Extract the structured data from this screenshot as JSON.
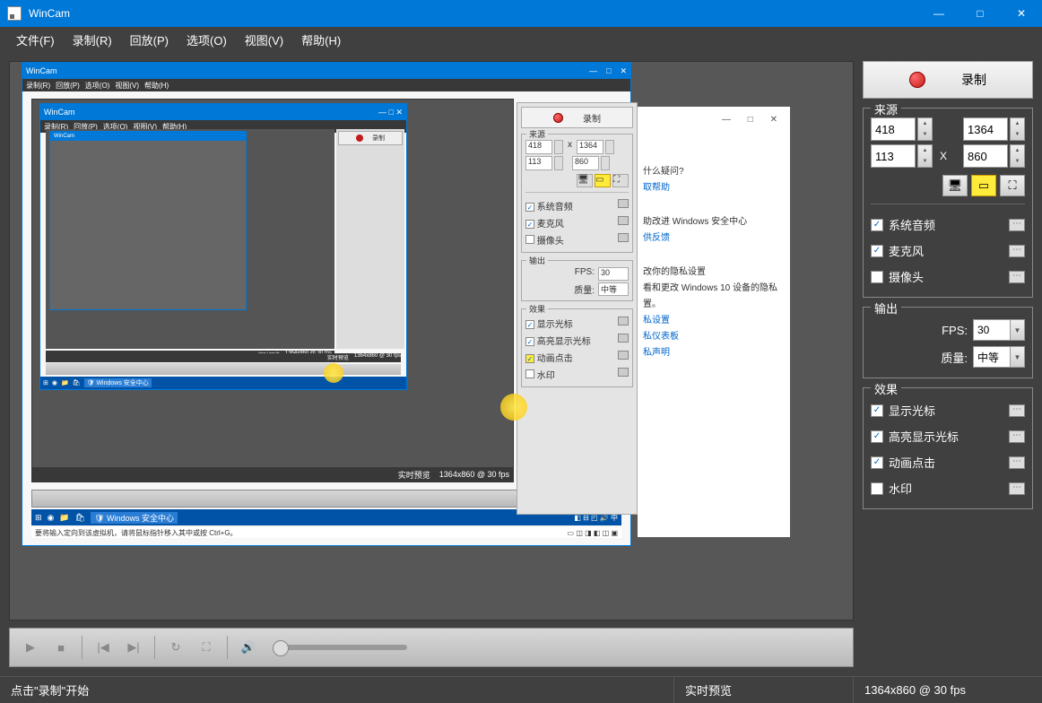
{
  "app": {
    "title": "WinCam"
  },
  "window_controls": {
    "min": "—",
    "max": "□",
    "close": "✕"
  },
  "menu": {
    "file": "文件(F)",
    "record": "录制(R)",
    "playback": "回放(P)",
    "options": "选项(O)",
    "view": "视图(V)",
    "help": "帮助(H)"
  },
  "record_button": {
    "label": "录制"
  },
  "panels": {
    "source": "来源",
    "output": "输出",
    "effects": "效果"
  },
  "source": {
    "x": "418",
    "y": "113",
    "w": "1364",
    "h": "860",
    "x_sep": "X"
  },
  "checks": {
    "system_audio": "系统音频",
    "microphone": "麦克风",
    "camera": "摄像头"
  },
  "output": {
    "fps_label": "FPS:",
    "fps_value": "30",
    "quality_label": "质量:",
    "quality_value": "中等"
  },
  "effects": {
    "show_cursor": "显示光标",
    "highlight_cursor": "高亮显示光标",
    "animate_click": "动画点击",
    "watermark": "水印"
  },
  "status": {
    "hint": "点击\"录制\"开始",
    "preview": "实时预览",
    "resolution": "1364x860 @ 30 fps"
  },
  "nested_status": {
    "preview": "实时预览",
    "resolution": "1364x860 @ 30 fps",
    "vm_hint": "要将输入定向到该虚拟机，请将鼠标指针移入其中或按 Ctrl+G。",
    "vm_hint2": "要将输入定向到该虚拟机，请将鼠标指针移入其中或按 Ctrl+G。",
    "wsec": "Windows 安全中心"
  },
  "nested_menu": {
    "record": "录制(R)",
    "playback": "回放(P)",
    "options": "选项(O)",
    "view": "视图(V)",
    "help": "帮助(H)"
  },
  "nested_panel": {
    "record": "录制",
    "source": "来源",
    "output": "输出",
    "effects": "效果",
    "x": "418",
    "y": "113",
    "w": "1364",
    "h": "860",
    "fps": "30",
    "quality": "中等",
    "sys_audio": "系统音频",
    "mic": "麦克风",
    "cam": "摄像头",
    "show_cursor": "显示光标",
    "highlight": "高亮显示光标",
    "anim_click": "动画点击",
    "watermark": "水印"
  },
  "nested_text": {
    "q1": "什么疑问?",
    "q2": "取帮助",
    "q3": "助改进 Windows 安全中心",
    "q4": "供反馈",
    "q5": "改你的隐私设置",
    "q6": "看和更改 Windows 10 设备的隐私",
    "q7": "私设置",
    "q8": "私仪表板",
    "q9": "私声明"
  }
}
